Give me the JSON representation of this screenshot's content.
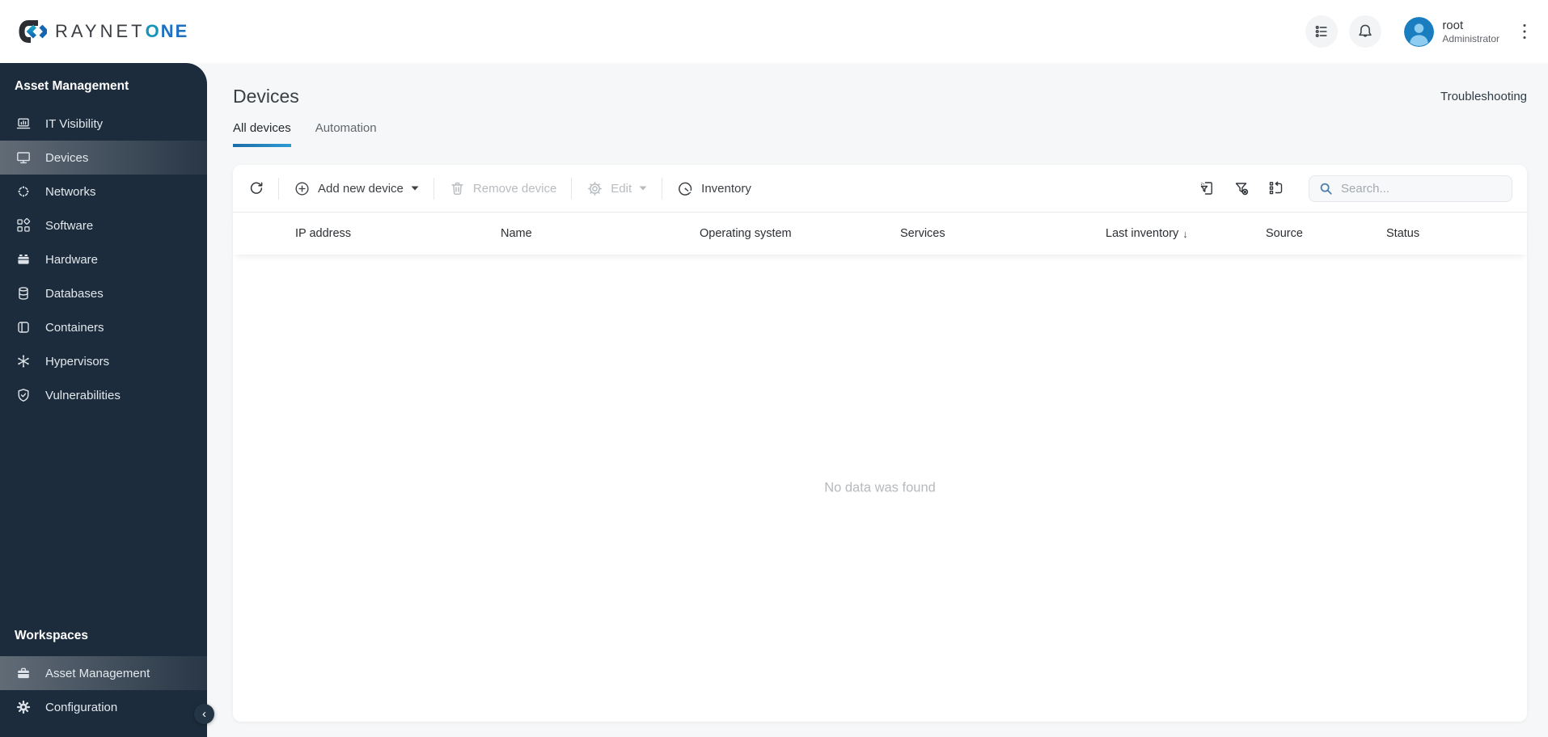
{
  "header": {
    "logo": {
      "brand_gray": "RAYNET",
      "brand_o": "O",
      "brand_ne": "NE"
    },
    "user": {
      "name": "root",
      "role": "Administrator"
    }
  },
  "sidebar": {
    "section_title": "Asset Management",
    "items": [
      {
        "label": "IT Visibility",
        "icon": "laptop-chart-icon",
        "active": false
      },
      {
        "label": "Devices",
        "icon": "monitor-icon",
        "active": true
      },
      {
        "label": "Networks",
        "icon": "network-icon",
        "active": false
      },
      {
        "label": "Software",
        "icon": "software-boxes-icon",
        "active": false
      },
      {
        "label": "Hardware",
        "icon": "hardware-box-icon",
        "active": false
      },
      {
        "label": "Databases",
        "icon": "database-icon",
        "active": false
      },
      {
        "label": "Containers",
        "icon": "container-icon",
        "active": false
      },
      {
        "label": "Hypervisors",
        "icon": "hypervisor-hub-icon",
        "active": false
      },
      {
        "label": "Vulnerabilities",
        "icon": "shield-check-icon",
        "active": false
      }
    ],
    "workspaces_title": "Workspaces",
    "workspace_items": [
      {
        "label": "Asset Management",
        "icon": "briefcase-icon",
        "active": true
      },
      {
        "label": "Configuration",
        "icon": "gear-icon",
        "active": false
      }
    ]
  },
  "page": {
    "title": "Devices",
    "troubleshooting": "Troubleshooting",
    "tabs": [
      {
        "label": "All devices",
        "active": true
      },
      {
        "label": "Automation",
        "active": false
      }
    ]
  },
  "toolbar": {
    "add_new_device": "Add new device",
    "remove_device": "Remove device",
    "edit": "Edit",
    "inventory": "Inventory",
    "search_placeholder": "Search..."
  },
  "table": {
    "columns": [
      "IP address",
      "Name",
      "Operating system",
      "Services",
      "Last inventory",
      "Source",
      "Status"
    ],
    "sorted_column": "Last inventory",
    "sort_direction": "desc",
    "sort_indicator": "↓",
    "empty_message": "No data was found"
  },
  "icons": {
    "collapse_chevron": "‹",
    "kebab": "⋮"
  },
  "colors": {
    "sidebar_bg": "#1d2c3c",
    "accent_blue": "#2380bc",
    "logo_o": "#1794b8",
    "logo_ne": "#1d70c2",
    "avatar_bg": "#1a7dc0"
  }
}
